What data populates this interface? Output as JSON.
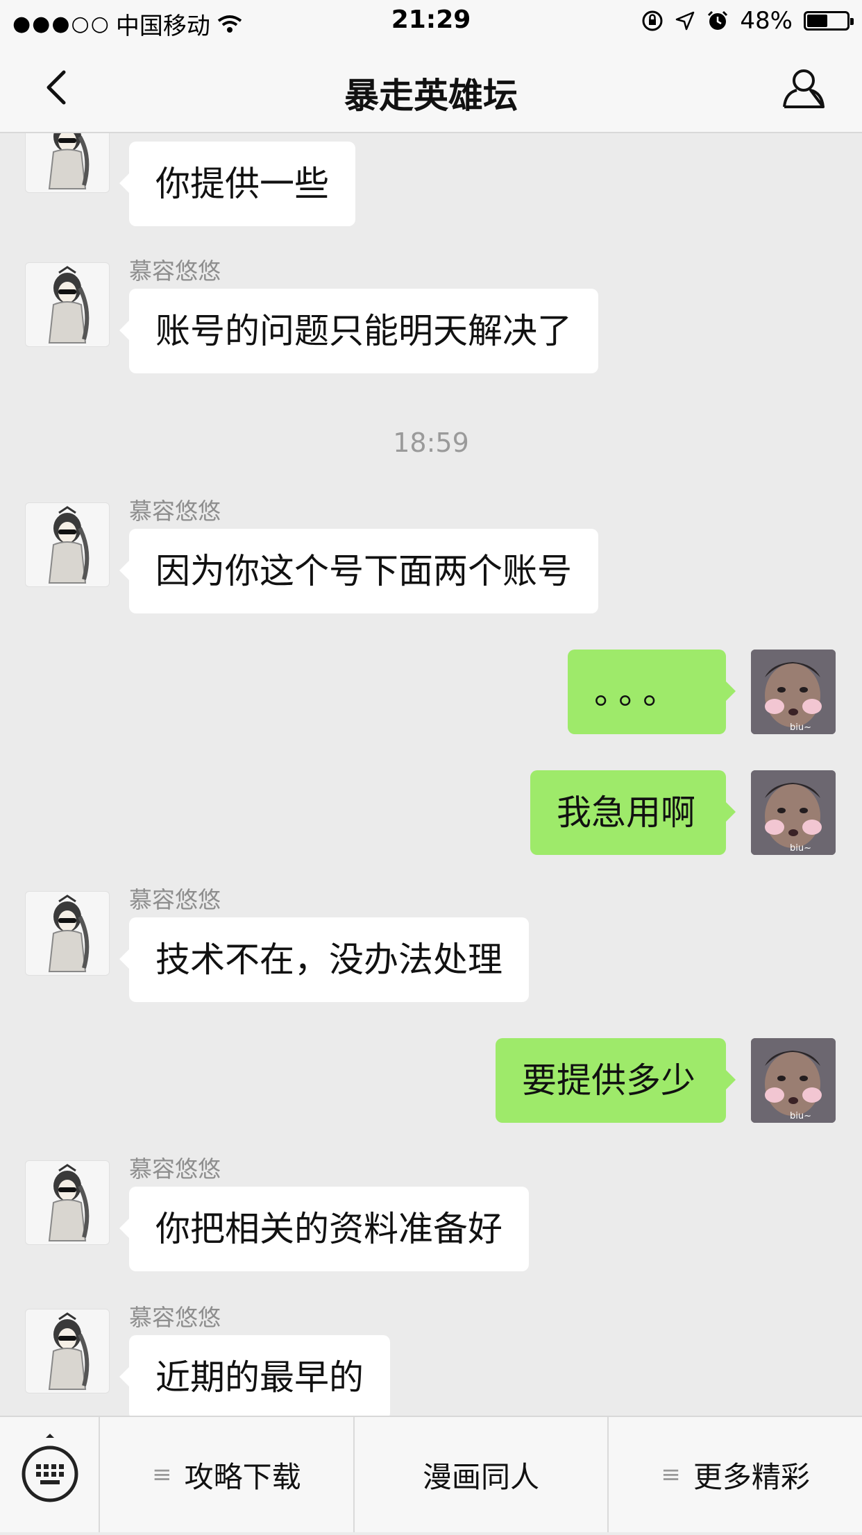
{
  "status_bar": {
    "signal": "●●●○○",
    "carrier": "中国移动",
    "time": "21:29",
    "battery": "48%",
    "battery_level": 0.48
  },
  "nav": {
    "title": "暴走英雄坛"
  },
  "messages": [
    {
      "from": "them",
      "name": "",
      "text": "你提供一些"
    },
    {
      "from": "them",
      "name": "慕容悠悠",
      "text": "账号的问题只能明天解决了"
    },
    {
      "type": "time",
      "text": "18:59"
    },
    {
      "from": "them",
      "name": "慕容悠悠",
      "text": "因为你这个号下面两个账号"
    },
    {
      "from": "me",
      "text": "。。。"
    },
    {
      "from": "me",
      "text": "我急用啊"
    },
    {
      "from": "them",
      "name": "慕容悠悠",
      "text": "技术不在，没办法处理"
    },
    {
      "from": "me",
      "text": "要提供多少"
    },
    {
      "from": "them",
      "name": "慕容悠悠",
      "text": "你把相关的资料准备好"
    },
    {
      "from": "them",
      "name": "慕容悠悠",
      "text": "近期的最早的"
    }
  ],
  "avatar_caption": "biu~",
  "bottom_menu": {
    "items": [
      "攻略下载",
      "漫画同人",
      "更多精彩"
    ]
  }
}
